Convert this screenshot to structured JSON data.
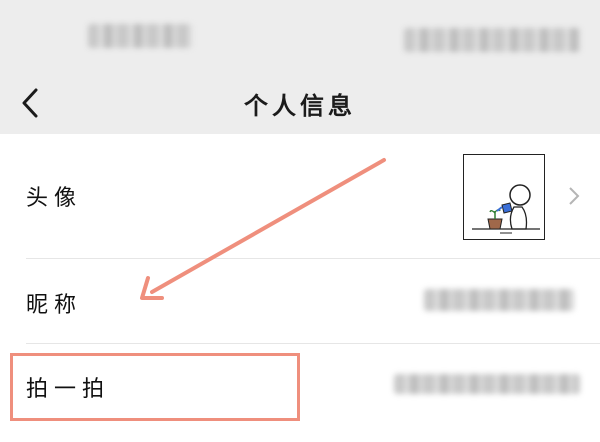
{
  "header": {
    "title": "个人信息",
    "back_icon": "back-chevron-icon"
  },
  "rows": [
    {
      "label": "头像",
      "value_type": "avatar",
      "chevron_icon": "chevron-right-icon"
    },
    {
      "label": "昵称",
      "value_type": "blurred-text"
    },
    {
      "label": "拍一拍",
      "value_type": "blurred-text"
    }
  ],
  "annotation": {
    "arrow_color": "#ef8f7d",
    "highlight_color": "#ef8f7d"
  }
}
